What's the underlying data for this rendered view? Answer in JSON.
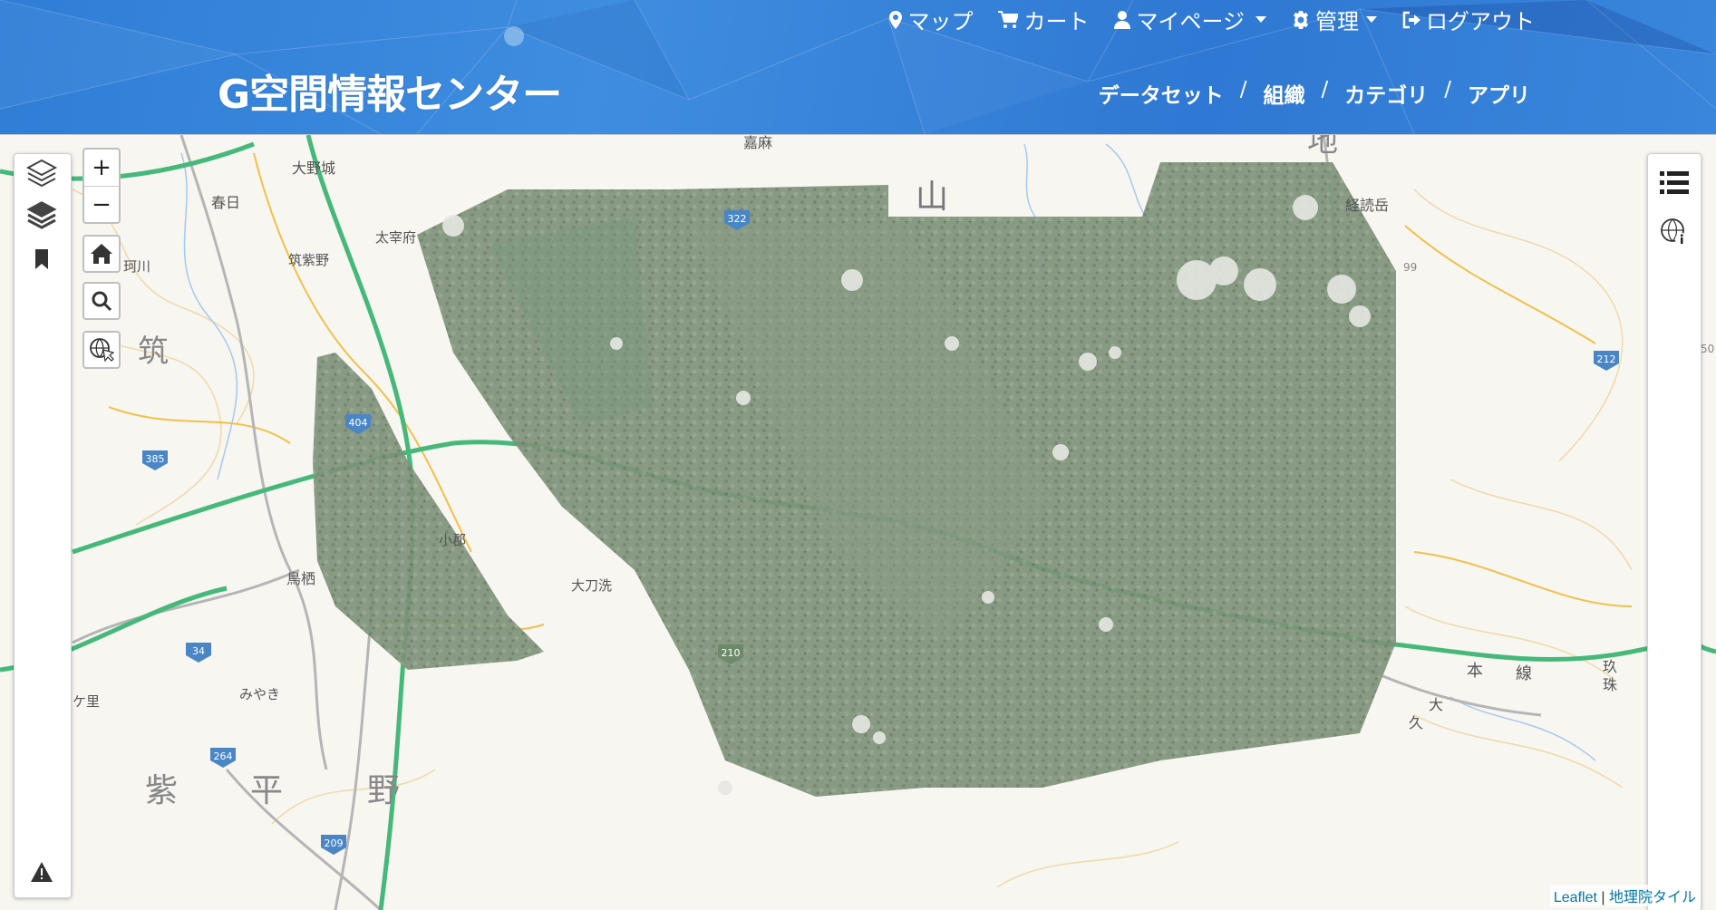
{
  "topnav": {
    "map": "マップ",
    "cart": "カート",
    "mypage": "マイページ",
    "admin": "管理",
    "logout": "ログアウト"
  },
  "logo": "G空間情報センター",
  "mainnav": {
    "datasets": "データセット",
    "organizations": "組織",
    "categories": "カテゴリ",
    "apps": "アプリ",
    "separator": "/"
  },
  "map": {
    "zoom_in": "+",
    "zoom_out": "−",
    "labels": [
      {
        "text": "大野城",
        "size": 16
      },
      {
        "text": "春日",
        "size": 16
      },
      {
        "text": "太宰府",
        "size": 15
      },
      {
        "text": "筑紫野",
        "size": 15
      },
      {
        "text": "珂川",
        "size": 15
      },
      {
        "text": "筑",
        "size": 34
      },
      {
        "text": "小郡",
        "size": 15
      },
      {
        "text": "鳥栖",
        "size": 16
      },
      {
        "text": "大刀洗",
        "size": 15
      },
      {
        "text": "みやき",
        "size": 15
      },
      {
        "text": "ケ里",
        "size": 15
      },
      {
        "text": "紫",
        "size": 36
      },
      {
        "text": "平",
        "size": 36
      },
      {
        "text": "野",
        "size": 36
      },
      {
        "text": "嘉麻",
        "size": 16
      },
      {
        "text": "山",
        "size": 36
      },
      {
        "text": "地",
        "size": 34
      },
      {
        "text": "経読岳",
        "size": 16
      },
      {
        "text": "本",
        "size": 18
      },
      {
        "text": "線",
        "size": 18
      },
      {
        "text": "玖",
        "size": 16
      },
      {
        "text": "珠",
        "size": 16
      },
      {
        "text": "久",
        "size": 16
      },
      {
        "text": "大",
        "size": 16
      }
    ],
    "route_shields": [
      "322",
      "404",
      "385",
      "34",
      "264",
      "209",
      "212",
      "210",
      "99",
      "50"
    ],
    "attribution": {
      "leaflet": "Leaflet",
      "separator": "|",
      "tiles": "地理院タイル"
    }
  },
  "colors": {
    "header": "#2f7dd6",
    "expressway": "#45b87a",
    "road": "#f2c04a",
    "river": "#8fb8e8",
    "photo": "#7f947a"
  }
}
